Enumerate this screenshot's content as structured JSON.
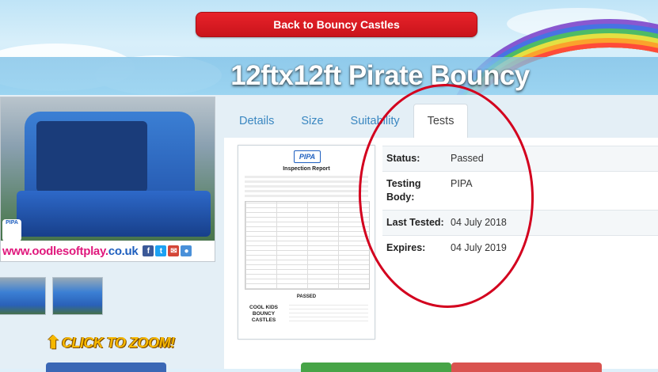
{
  "nav": {
    "back_label": "Back to Bouncy Castles"
  },
  "product": {
    "title": "12ftx12ft Pirate Bouncy",
    "site_url_pink": "www.oodlesoftplay.",
    "site_url_blue": "co.uk",
    "badge": "PIPA",
    "zoom_label": "CLICK TO ZOOM!"
  },
  "tabs": [
    {
      "label": "Details",
      "active": false
    },
    {
      "label": "Size",
      "active": false
    },
    {
      "label": "Suitability",
      "active": false
    },
    {
      "label": "Tests",
      "active": true
    }
  ],
  "certificate": {
    "logo": "PIPA",
    "heading": "Inspection Report",
    "result": "PASSED",
    "brand": "COOL KIDS BOUNCY CASTLES"
  },
  "test_info": [
    {
      "label": "Status:",
      "value": "Passed"
    },
    {
      "label": "Testing Body:",
      "value": "PIPA"
    },
    {
      "label": "Last Tested:",
      "value": "04 July 2018"
    },
    {
      "label": "Expires:",
      "value": "04 July 2019"
    }
  ],
  "colors": {
    "accent_red": "#d3001e",
    "tab_link": "#3a87c1",
    "button_red": "#e8222a"
  }
}
